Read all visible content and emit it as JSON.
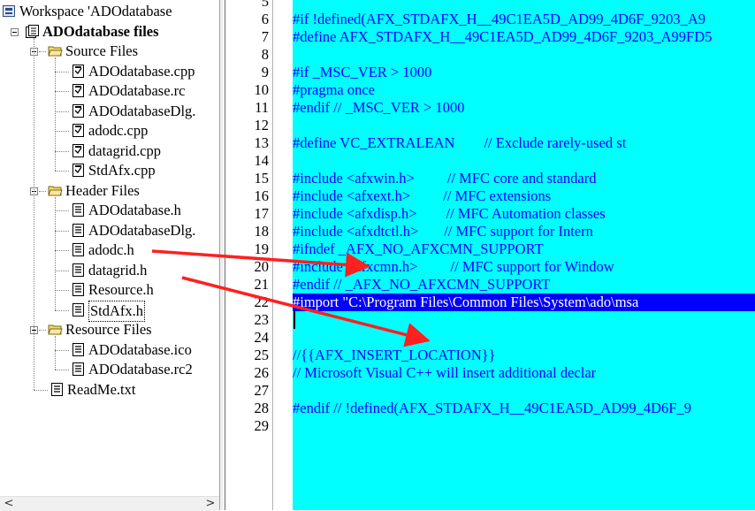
{
  "workspace": {
    "title": "Workspace 'ADOdatabase",
    "project": "ADOdatabase files",
    "folders": [
      {
        "name": "Source Files",
        "files": [
          "ADOdatabase.cpp",
          "ADOdatabase.rc",
          "ADOdatabaseDlg.",
          "adodc.cpp",
          "datagrid.cpp",
          "StdAfx.cpp"
        ]
      },
      {
        "name": "Header Files",
        "files": [
          "ADOdatabase.h",
          "ADOdatabaseDlg.",
          "adodc.h",
          "datagrid.h",
          "Resource.h",
          "StdAfx.h"
        ]
      },
      {
        "name": "Resource Files",
        "files": [
          "ADOdatabase.ico",
          "ADOdatabase.rc2"
        ]
      }
    ],
    "readme": "ReadMe.txt",
    "selected_file": "StdAfx.h"
  },
  "scrollbar": {
    "left_arrow": "<",
    "right_arrow": ">"
  },
  "editor": {
    "line_numbers": [
      "5",
      "6",
      "7",
      "8",
      "9",
      "10",
      "11",
      "12",
      "13",
      "14",
      "15",
      "16",
      "17",
      "18",
      "19",
      "20",
      "21",
      "22",
      "23",
      "24",
      "25",
      "26",
      "27",
      "28",
      "29"
    ],
    "lines": [
      {
        "text": "",
        "style": "code"
      },
      {
        "text": "#if !defined(AFX_STDAFX_H__49C1EA5D_AD99_4D6F_9203_A9",
        "style": "code"
      },
      {
        "text": "#define AFX_STDAFX_H__49C1EA5D_AD99_4D6F_9203_A99FD5",
        "style": "code"
      },
      {
        "text": "",
        "style": "code"
      },
      {
        "text": "#if _MSC_VER > 1000",
        "style": "code"
      },
      {
        "text": "#pragma once",
        "style": "code"
      },
      {
        "text": "#endif // _MSC_VER > 1000",
        "style": "code"
      },
      {
        "text": "",
        "style": "code"
      },
      {
        "text": "#define VC_EXTRALEAN        // Exclude rarely-used st",
        "style": "code"
      },
      {
        "text": "",
        "style": "code"
      },
      {
        "text": "#include <afxwin.h>         // MFC core and standard",
        "style": "code"
      },
      {
        "text": "#include <afxext.h>         // MFC extensions",
        "style": "code"
      },
      {
        "text": "#include <afxdisp.h>        // MFC Automation classes",
        "style": "code"
      },
      {
        "text": "#include <afxdtctl.h>       // MFC support for Intern",
        "style": "code"
      },
      {
        "text": "#ifndef _AFX_NO_AFXCMN_SUPPORT",
        "style": "code"
      },
      {
        "text": "#include <afxcmn.h>         // MFC support for Window",
        "style": "code"
      },
      {
        "text": "#endif // _AFX_NO_AFXCMN_SUPPORT",
        "style": "code"
      },
      {
        "text": "#import \"C:\\Program Files\\Common Files\\System\\ado\\msa",
        "style": "highlight"
      },
      {
        "text": "",
        "style": "code"
      },
      {
        "text": "",
        "style": "code"
      },
      {
        "text": "//{{AFX_INSERT_LOCATION}}",
        "style": "code"
      },
      {
        "text": "// Microsoft Visual C++ will insert additional declar",
        "style": "code"
      },
      {
        "text": "",
        "style": "code"
      },
      {
        "text": "#endif // !defined(AFX_STDAFX_H__49C1EA5D_AD99_4D6F_9",
        "style": "code"
      },
      {
        "text": "",
        "style": "code"
      }
    ],
    "colors": {
      "background": "#00ffff",
      "text": "#0000ff",
      "highlight_bg": "#0000ff",
      "highlight_text": "#ffffff"
    }
  },
  "annotations": {
    "arrow_color": "#ff2020",
    "arrows": [
      {
        "from": "adodc.h",
        "to": "#include <afxcmn.h>"
      },
      {
        "from": "datagrid.h",
        "to": "line 23"
      }
    ]
  },
  "icons": {
    "workspace": "workspace-icon",
    "project": "project-icon",
    "folder": "folder-open-icon",
    "source_file": "source-file-icon",
    "header_file": "header-file-icon"
  }
}
